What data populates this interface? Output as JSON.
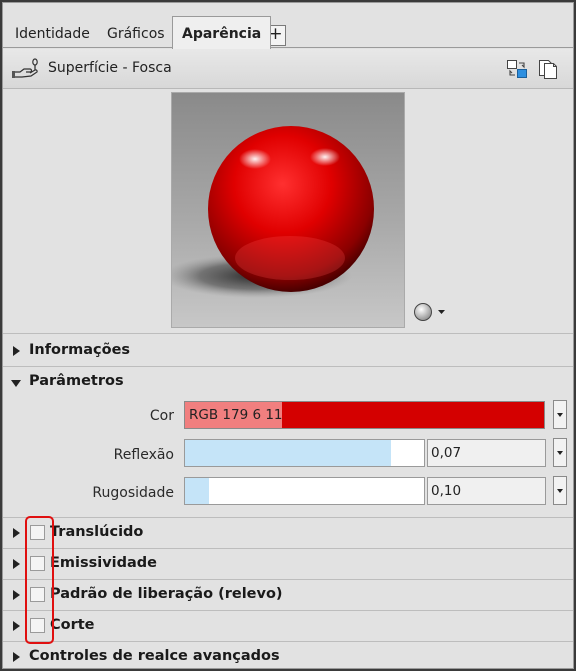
{
  "tabs": [
    {
      "label": "Identidade",
      "active": false
    },
    {
      "label": "Gráficos",
      "active": false
    },
    {
      "label": "Aparência",
      "active": true
    }
  ],
  "tab_add_label": "+",
  "material": {
    "name": "Superfície - Fosca",
    "icon": "material-hand-icon",
    "toolbar": [
      "replace-asset-icon",
      "duplicate-asset-icon"
    ]
  },
  "preview": {
    "subject": "red glossy sphere",
    "scene_options_icon": "scene-sphere-icon"
  },
  "sections": {
    "informacoes": {
      "label": "Informações",
      "expanded": false
    },
    "parametros": {
      "label": "Parâmetros",
      "expanded": true
    }
  },
  "parameters": {
    "cor": {
      "label": "Cor",
      "value": "RGB 179 6 11",
      "color": "#D40000",
      "swatch_color": "#F17F7F"
    },
    "reflexao": {
      "label": "Reflexão",
      "value": "0,07",
      "level_fraction": 0.86
    },
    "rugosidade": {
      "label": "Rugosidade",
      "value": "0,10",
      "level_fraction": 0.1
    }
  },
  "optional_sections": [
    {
      "label": "Translúcido",
      "checked": false
    },
    {
      "label": "Emissividade",
      "checked": false
    },
    {
      "label": "Padrão de liberação (relevo)",
      "checked": false
    },
    {
      "label": "Corte",
      "checked": false
    }
  ],
  "advanced": {
    "label": "Controles de realce avançados"
  },
  "highlight_color": "#E01010"
}
